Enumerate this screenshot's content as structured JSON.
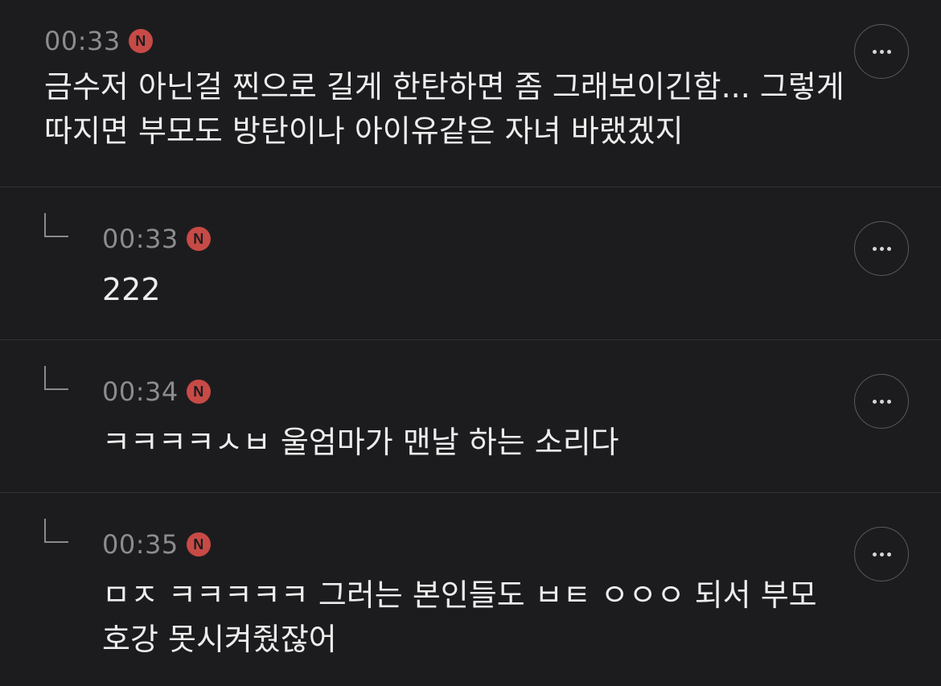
{
  "comments": [
    {
      "time": "00:33",
      "badge": "N",
      "text": "금수저 아닌걸 찐으로 길게 한탄하면 좀 그래보이긴함... 그렇게따지면 부모도 방탄이나 아이유같은 자녀 바랬겠지",
      "is_reply": false
    },
    {
      "time": "00:33",
      "badge": "N",
      "text": "222",
      "is_reply": true
    },
    {
      "time": "00:34",
      "badge": "N",
      "text": "ㅋㅋㅋㅋㅅㅂ 울엄마가 맨날 하는 소리다",
      "is_reply": true
    },
    {
      "time": "00:35",
      "badge": "N",
      "text": "ㅁㅈ ㅋㅋㅋㅋㅋ 그러는 본인들도 ㅂㅌ ㅇㅇㅇ 되서 부모 호강 못시켜줬잖어",
      "is_reply": true
    }
  ],
  "icons": {
    "reply_indicator": "reply-arrow-icon",
    "new_badge": "new-badge-icon",
    "more_button": "more-options-icon"
  },
  "colors": {
    "background": "#1c1c1e",
    "badge": "#c74a46",
    "time_text": "#8c8c90",
    "body_text": "#ededed"
  }
}
